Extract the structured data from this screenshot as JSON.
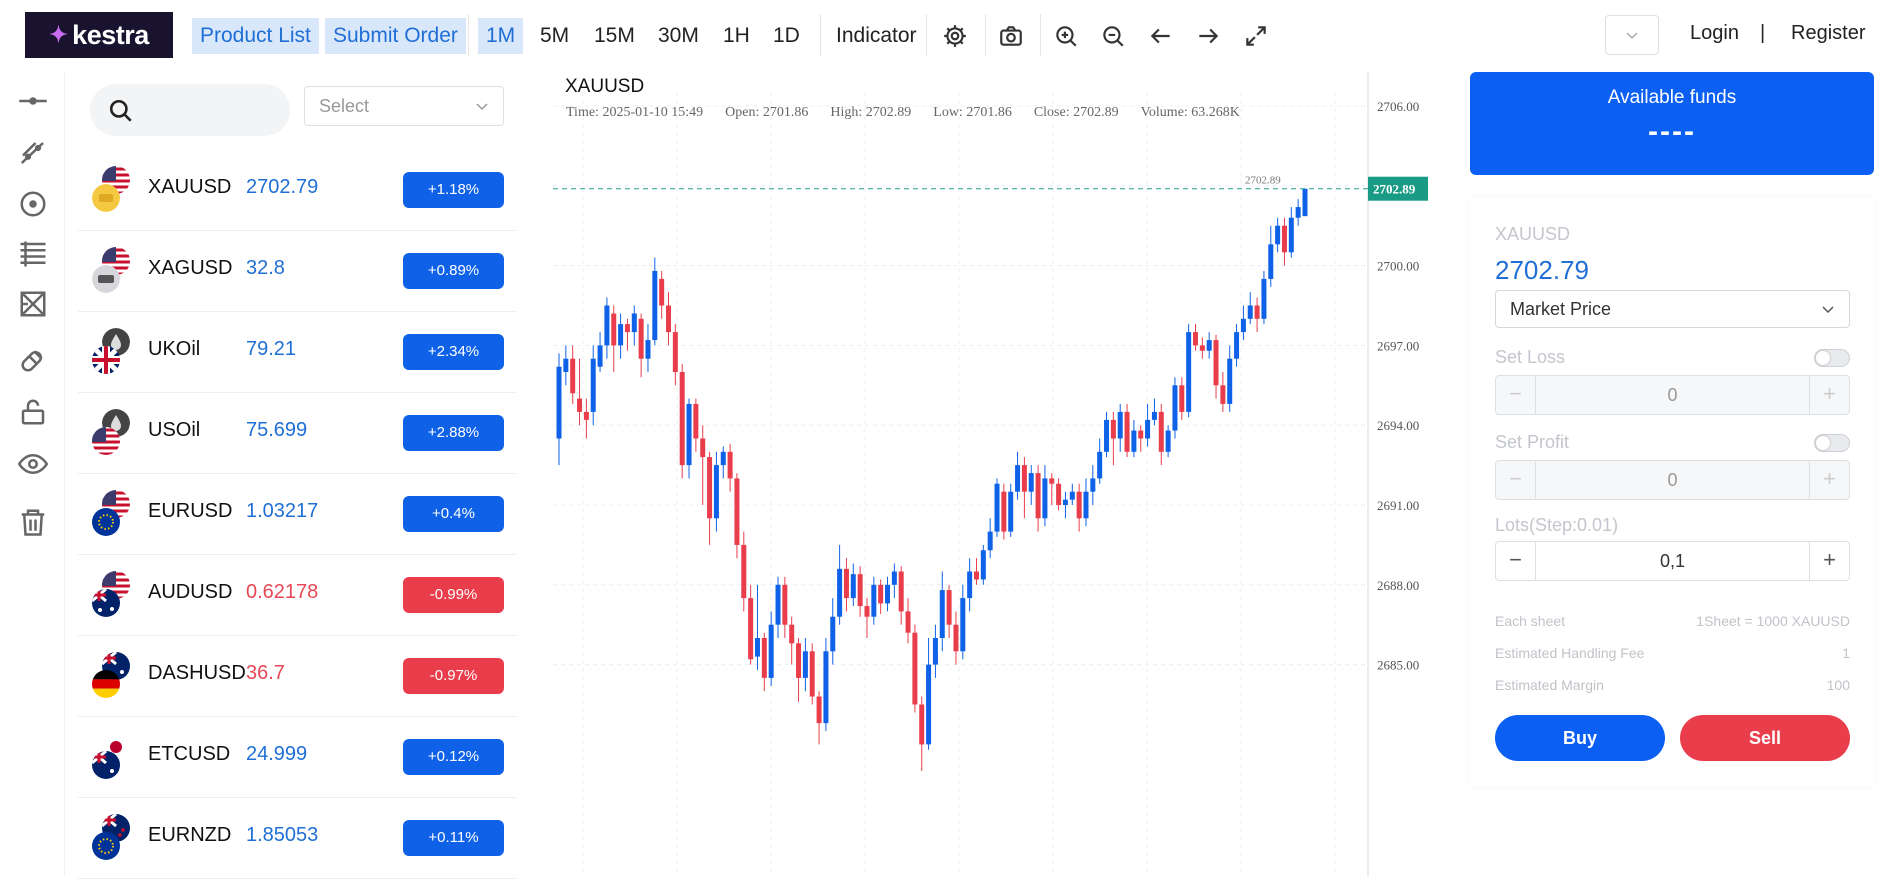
{
  "brand": {
    "name": "kestra"
  },
  "toolbar": {
    "product_list": "Product List",
    "submit_order": "Submit Order",
    "timeframes": [
      "1M",
      "5M",
      "15M",
      "30M",
      "1H",
      "1D"
    ],
    "active_timeframe": "1M",
    "indicator": "Indicator",
    "icons": [
      "gear-icon",
      "camera-icon",
      "zoom-in-icon",
      "zoom-out-icon",
      "arrow-left-icon",
      "arrow-right-icon",
      "fullscreen-icon"
    ]
  },
  "auth": {
    "login": "Login",
    "divider": "|",
    "register": "Register"
  },
  "left_tools": [
    "horizontal-line-icon",
    "trend-line-icon",
    "circle-icon",
    "fib-lines-icon",
    "pattern-icon",
    "magnet-icon",
    "lock-icon",
    "eye-icon",
    "trash-icon"
  ],
  "product_list": {
    "select_placeholder": "Select",
    "items": [
      {
        "symbol": "XAUUSD",
        "price": "2702.79",
        "change": "+1.18%",
        "direction": "up"
      },
      {
        "symbol": "XAGUSD",
        "price": "32.8",
        "change": "+0.89%",
        "direction": "up"
      },
      {
        "symbol": "UKOil",
        "price": "79.21",
        "change": "+2.34%",
        "direction": "up"
      },
      {
        "symbol": "USOil",
        "price": "75.699",
        "change": "+2.88%",
        "direction": "up"
      },
      {
        "symbol": "EURUSD",
        "price": "1.03217",
        "change": "+0.4%",
        "direction": "up"
      },
      {
        "symbol": "AUDUSD",
        "price": "0.62178",
        "change": "-0.99%",
        "direction": "down"
      },
      {
        "symbol": "DASHUSD",
        "price": "36.7",
        "change": "-0.97%",
        "direction": "down"
      },
      {
        "symbol": "ETCUSD",
        "price": "24.999",
        "change": "+0.12%",
        "direction": "up"
      },
      {
        "symbol": "EURNZD",
        "price": "1.85053",
        "change": "+0.11%",
        "direction": "up"
      }
    ]
  },
  "chart": {
    "symbol": "XAUUSD",
    "info": {
      "time": "Time: 2025-01-10 15:49",
      "open": "Open: 2701.86",
      "high": "High: 2702.89",
      "low": "Low: 2701.86",
      "close": "Close: 2702.89",
      "volume": "Volume: 63.268K"
    },
    "last_price_label": "2702.89",
    "last_price_marker": "2702.89",
    "up_color": "#0f62e8",
    "down_color": "#ea3d4c"
  },
  "chart_data": {
    "type": "candlestick",
    "title": "XAUUSD",
    "y_ticks": [
      "2706.00",
      "2703.00",
      "2700.00",
      "2697.00",
      "2694.00",
      "2691.00",
      "2688.00",
      "2685.00"
    ],
    "ylim": [
      2683.5,
      2708
    ],
    "last_price": 2702.89,
    "candles": [
      [
        2693.5,
        2696.2,
        2696.7,
        2692.5
      ],
      [
        2696.0,
        2696.5,
        2697.0,
        2695.5
      ],
      [
        2696.5,
        2695.2,
        2697.0,
        2694.8
      ],
      [
        2695.0,
        2694.5,
        2696.5,
        2694.0
      ],
      [
        2694.5,
        2694.2,
        2695.0,
        2693.5
      ],
      [
        2694.5,
        2696.5,
        2697.0,
        2694.0
      ],
      [
        2696.2,
        2697.0,
        2697.5,
        2696.0
      ],
      [
        2697.0,
        2698.5,
        2698.8,
        2696.5
      ],
      [
        2698.2,
        2697.0,
        2698.5,
        2696.0
      ],
      [
        2697.0,
        2697.8,
        2698.2,
        2696.5
      ],
      [
        2697.8,
        2697.5,
        2698.0,
        2696.8
      ],
      [
        2697.5,
        2698.2,
        2698.5,
        2697.0
      ],
      [
        2698.0,
        2696.5,
        2698.2,
        2695.8
      ],
      [
        2696.5,
        2697.2,
        2697.8,
        2696.0
      ],
      [
        2697.2,
        2699.8,
        2700.3,
        2697.0
      ],
      [
        2699.5,
        2698.5,
        2699.8,
        2698.0
      ],
      [
        2698.5,
        2697.5,
        2699.0,
        2697.0
      ],
      [
        2697.5,
        2696.0,
        2697.8,
        2695.5
      ],
      [
        2696.0,
        2692.5,
        2696.3,
        2692.0
      ],
      [
        2692.5,
        2694.8,
        2695.0,
        2692.0
      ],
      [
        2694.8,
        2693.5,
        2695.0,
        2693.0
      ],
      [
        2693.5,
        2692.8,
        2694.0,
        2691.0
      ],
      [
        2692.8,
        2690.5,
        2693.0,
        2689.5
      ],
      [
        2690.5,
        2692.5,
        2693.0,
        2690.0
      ],
      [
        2692.5,
        2693.0,
        2693.2,
        2692.0
      ],
      [
        2693.0,
        2692.0,
        2693.3,
        2691.5
      ],
      [
        2692.0,
        2689.5,
        2692.2,
        2689.0
      ],
      [
        2689.5,
        2687.5,
        2690.0,
        2687.0
      ],
      [
        2687.5,
        2685.2,
        2688.0,
        2685.0
      ],
      [
        2685.3,
        2686.0,
        2688.0,
        2684.8
      ],
      [
        2686.0,
        2684.5,
        2686.2,
        2684.0
      ],
      [
        2684.5,
        2686.5,
        2687.0,
        2684.2
      ],
      [
        2686.5,
        2688.0,
        2688.3,
        2686.0
      ],
      [
        2688.0,
        2686.5,
        2688.3,
        2686.0
      ],
      [
        2686.5,
        2685.8,
        2686.8,
        2685.0
      ],
      [
        2685.8,
        2684.5,
        2686.0,
        2683.6
      ],
      [
        2684.5,
        2685.5,
        2686.0,
        2684.0
      ],
      [
        2685.5,
        2683.8,
        2685.8,
        2683.5
      ],
      [
        2683.8,
        2682.8,
        2684.0,
        2682.0
      ],
      [
        2682.8,
        2685.5,
        2686.0,
        2682.5
      ],
      [
        2685.5,
        2686.8,
        2687.5,
        2685.0
      ],
      [
        2686.8,
        2688.6,
        2689.5,
        2686.5
      ],
      [
        2688.6,
        2687.5,
        2689.0,
        2687.0
      ],
      [
        2687.5,
        2688.4,
        2688.8,
        2687.2
      ],
      [
        2688.4,
        2687.2,
        2688.7,
        2686.8
      ],
      [
        2687.2,
        2686.8,
        2687.5,
        2686.0
      ],
      [
        2686.8,
        2688.0,
        2688.3,
        2686.5
      ],
      [
        2688.0,
        2687.3,
        2688.2,
        2686.9
      ],
      [
        2687.3,
        2688.0,
        2688.3,
        2687.0
      ],
      [
        2688.0,
        2688.5,
        2688.8,
        2687.5
      ],
      [
        2688.5,
        2687.0,
        2688.7,
        2686.5
      ],
      [
        2687.0,
        2686.2,
        2687.5,
        2685.8
      ],
      [
        2686.2,
        2683.5,
        2686.5,
        2683.2
      ],
      [
        2683.5,
        2682.0,
        2683.8,
        2681.0
      ],
      [
        2682.0,
        2685.0,
        2686.0,
        2681.8
      ],
      [
        2685.0,
        2686.0,
        2686.5,
        2684.5
      ],
      [
        2686.0,
        2687.8,
        2688.5,
        2685.5
      ],
      [
        2687.8,
        2686.5,
        2688.0,
        2686.0
      ],
      [
        2686.5,
        2685.5,
        2687.0,
        2685.0
      ],
      [
        2685.5,
        2687.5,
        2688.0,
        2685.2
      ],
      [
        2687.5,
        2688.5,
        2689.0,
        2687.0
      ],
      [
        2688.5,
        2688.2,
        2689.0,
        2688.0
      ],
      [
        2688.2,
        2689.3,
        2689.5,
        2688.0
      ],
      [
        2689.3,
        2690.0,
        2690.5,
        2689.0
      ],
      [
        2690.0,
        2691.8,
        2692.0,
        2689.8
      ],
      [
        2691.5,
        2690.0,
        2691.8,
        2689.7
      ],
      [
        2690.0,
        2691.5,
        2691.8,
        2689.8
      ],
      [
        2691.5,
        2692.5,
        2693.0,
        2691.2
      ],
      [
        2692.5,
        2691.5,
        2692.8,
        2690.5
      ],
      [
        2691.5,
        2692.2,
        2692.5,
        2691.0
      ],
      [
        2692.2,
        2690.5,
        2692.5,
        2690.0
      ],
      [
        2690.5,
        2692.0,
        2692.5,
        2690.2
      ],
      [
        2692.0,
        2691.8,
        2692.2,
        2691.0
      ],
      [
        2691.8,
        2691.0,
        2692.0,
        2690.8
      ],
      [
        2691.0,
        2691.2,
        2691.5,
        2690.5
      ],
      [
        2691.2,
        2691.5,
        2691.8,
        2691.0
      ],
      [
        2691.5,
        2690.5,
        2691.8,
        2690.0
      ],
      [
        2690.5,
        2691.5,
        2692.0,
        2690.2
      ],
      [
        2691.5,
        2692.0,
        2692.5,
        2691.0
      ],
      [
        2692.0,
        2693.0,
        2693.5,
        2691.8
      ],
      [
        2693.0,
        2694.2,
        2694.5,
        2692.8
      ],
      [
        2694.2,
        2693.5,
        2694.5,
        2692.5
      ],
      [
        2693.5,
        2694.5,
        2694.8,
        2693.0
      ],
      [
        2694.5,
        2693.0,
        2694.8,
        2692.8
      ],
      [
        2693.0,
        2693.8,
        2694.2,
        2692.8
      ],
      [
        2693.8,
        2693.5,
        2694.0,
        2693.0
      ],
      [
        2693.5,
        2694.2,
        2694.8,
        2693.2
      ],
      [
        2694.2,
        2694.5,
        2695.0,
        2694.0
      ],
      [
        2694.5,
        2693.0,
        2694.8,
        2692.5
      ],
      [
        2693.0,
        2693.8,
        2694.0,
        2692.8
      ],
      [
        2693.8,
        2695.5,
        2695.8,
        2693.5
      ],
      [
        2695.5,
        2694.5,
        2695.8,
        2694.2
      ],
      [
        2694.5,
        2697.5,
        2697.8,
        2694.3
      ],
      [
        2697.5,
        2697.0,
        2697.8,
        2696.8
      ],
      [
        2697.0,
        2696.8,
        2697.3,
        2696.5
      ],
      [
        2696.8,
        2697.2,
        2697.5,
        2696.5
      ],
      [
        2697.2,
        2695.5,
        2697.4,
        2695.0
      ],
      [
        2695.5,
        2694.8,
        2696.0,
        2694.5
      ],
      [
        2694.8,
        2696.5,
        2697.0,
        2694.5
      ],
      [
        2696.5,
        2697.5,
        2697.8,
        2696.2
      ],
      [
        2697.5,
        2698.0,
        2698.5,
        2697.2
      ],
      [
        2698.0,
        2698.5,
        2699.0,
        2697.8
      ],
      [
        2698.5,
        2698.0,
        2698.8,
        2697.5
      ],
      [
        2698.0,
        2699.5,
        2699.8,
        2697.8
      ],
      [
        2699.5,
        2700.8,
        2701.5,
        2699.2
      ],
      [
        2700.8,
        2701.5,
        2701.8,
        2700.5
      ],
      [
        2701.5,
        2700.5,
        2701.8,
        2700.0
      ],
      [
        2700.5,
        2701.8,
        2702.2,
        2700.3
      ],
      [
        2701.8,
        2702.2,
        2702.5,
        2701.5
      ],
      [
        2701.86,
        2702.89,
        2702.89,
        2701.86
      ]
    ]
  },
  "order_panel": {
    "funds_title": "Available funds",
    "funds_value": "----",
    "symbol": "XAUUSD",
    "price": "2702.79",
    "order_type": "Market Price",
    "set_loss_label": "Set Loss",
    "set_loss_value": "0",
    "set_profit_label": "Set Profit",
    "set_profit_value": "0",
    "lots_label": "Lots(Step:0.01)",
    "lots_value": "0,1",
    "each_sheet_label": "Each sheet",
    "each_sheet_value": "1Sheet = 1000 XAUUSD",
    "fee_label": "Estimated Handling Fee",
    "fee_value": "1",
    "margin_label": "Estimated Margin",
    "margin_value": "100",
    "buy": "Buy",
    "sell": "Sell",
    "minus": "−",
    "plus": "+",
    "buy_color": "#0b5ff3",
    "sell_color": "#ea3d4c"
  }
}
